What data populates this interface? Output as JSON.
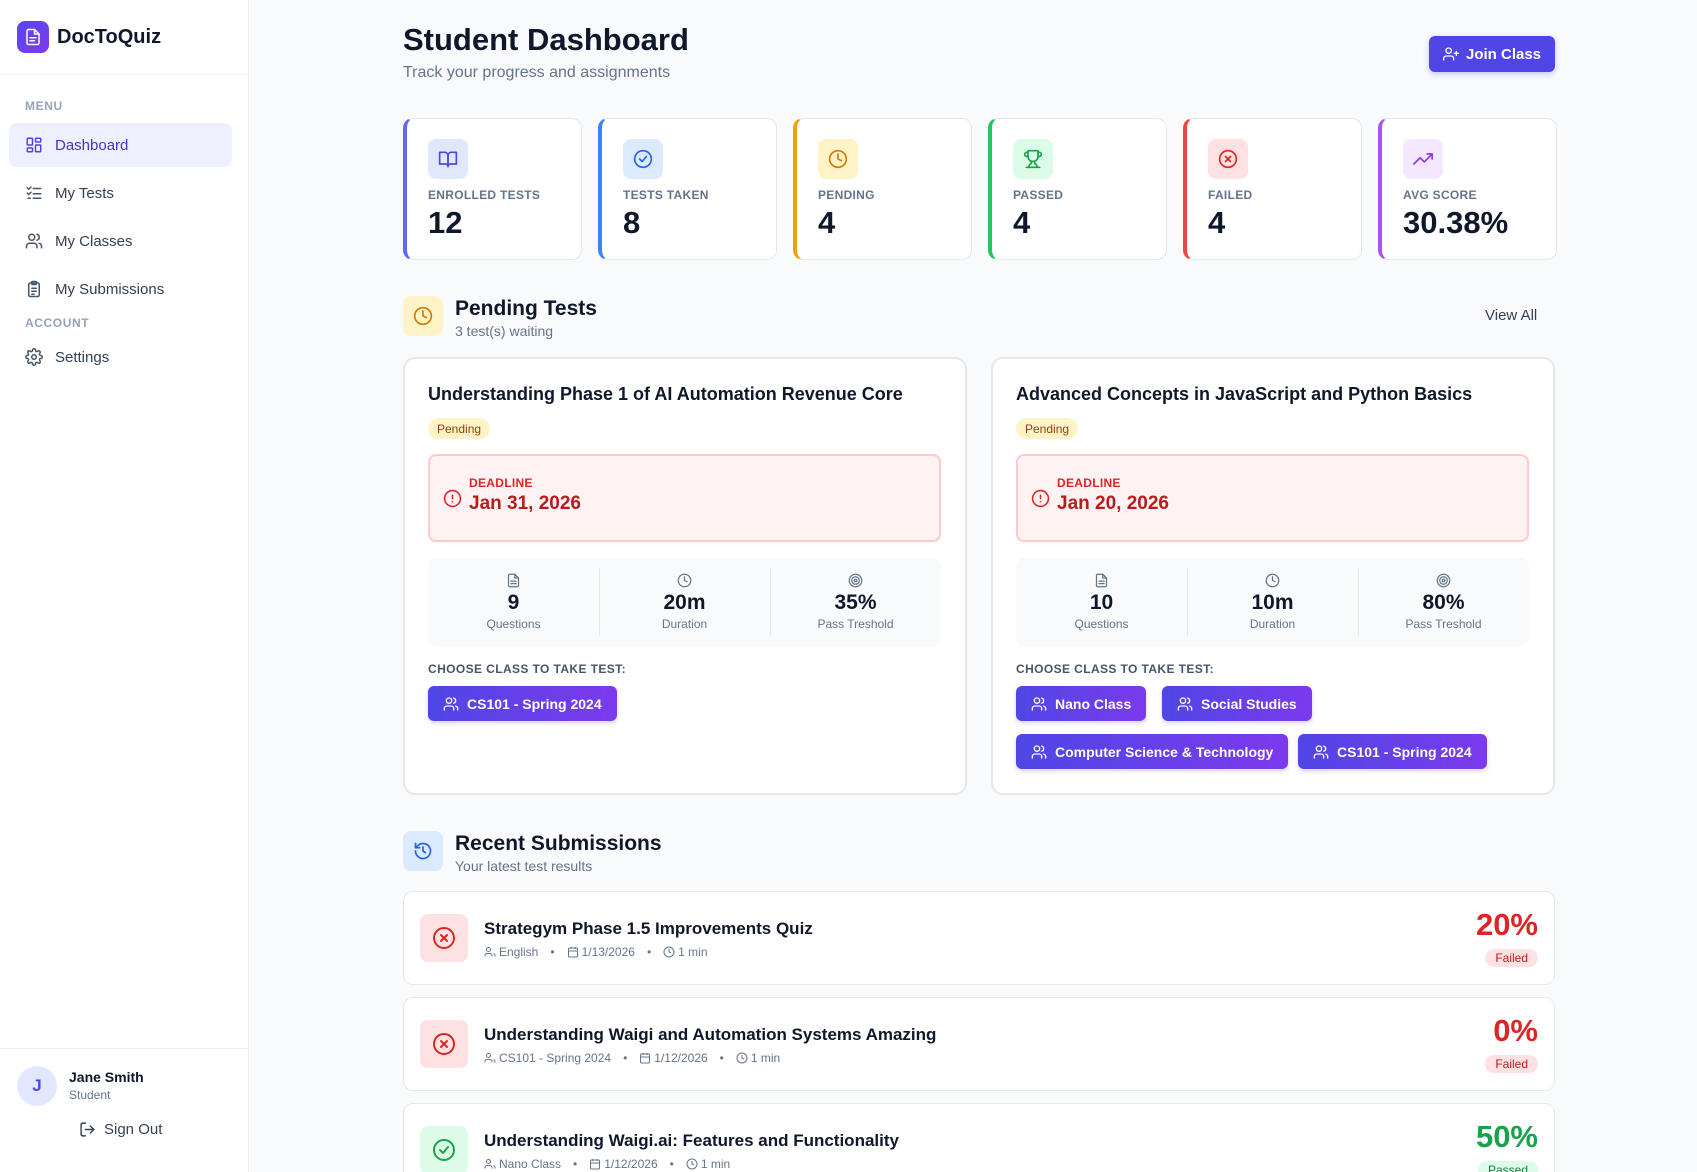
{
  "brand": {
    "name": "DocToQuiz"
  },
  "sidebar": {
    "menu_label": "MENU",
    "account_label": "ACCOUNT",
    "items": [
      {
        "label": "Dashboard",
        "icon": "dashboard-icon"
      },
      {
        "label": "My Tests",
        "icon": "list-check-icon"
      },
      {
        "label": "My Classes",
        "icon": "users-icon"
      },
      {
        "label": "My Submissions",
        "icon": "clipboard-icon"
      },
      {
        "label": "Settings",
        "icon": "gear-icon"
      }
    ],
    "user": {
      "initial": "J",
      "name": "Jane Smith",
      "role": "Student"
    },
    "sign_out": "Sign Out"
  },
  "header": {
    "title": "Student Dashboard",
    "subtitle": "Track your progress and assignments",
    "join_button": "Join Class"
  },
  "stats": [
    {
      "label": "ENROLLED TESTS",
      "value": "12",
      "color": "#6366f1",
      "icon": "book-icon"
    },
    {
      "label": "TESTS TAKEN",
      "value": "8",
      "color": "#3b82f6",
      "icon": "check-circle-icon"
    },
    {
      "label": "PENDING",
      "value": "4",
      "color": "#f59e0b",
      "icon": "clock-icon"
    },
    {
      "label": "PASSED",
      "value": "4",
      "color": "#22c55e",
      "icon": "trophy-icon"
    },
    {
      "label": "FAILED",
      "value": "4",
      "color": "#ef4444",
      "icon": "x-circle-icon"
    },
    {
      "label": "AVG SCORE",
      "value": "30.38%",
      "color": "#a855f7",
      "icon": "trending-up-icon"
    }
  ],
  "pending": {
    "title": "Pending Tests",
    "subtitle": "3 test(s) waiting",
    "view_all": "View All",
    "tests": [
      {
        "title": "Understanding Phase 1 of AI Automation Revenue Core",
        "status": "Pending",
        "deadline_label": "DEADLINE",
        "deadline": "Jan 31, 2026",
        "questions": "9",
        "questions_label": "Questions",
        "duration": "20m",
        "duration_label": "Duration",
        "pass": "35%",
        "pass_label": "Pass Treshold",
        "choose_label": "CHOOSE CLASS TO TAKE TEST:",
        "classes": [
          "CS101 - Spring 2024"
        ]
      },
      {
        "title": "Advanced Concepts in JavaScript and Python Basics",
        "status": "Pending",
        "deadline_label": "DEADLINE",
        "deadline": "Jan 20, 2026",
        "questions": "10",
        "questions_label": "Questions",
        "duration": "10m",
        "duration_label": "Duration",
        "pass": "80%",
        "pass_label": "Pass Treshold",
        "choose_label": "CHOOSE CLASS TO TAKE TEST:",
        "classes": [
          "Nano Class",
          "Social Studies",
          "Computer Science & Technology",
          "CS101 - Spring 2024"
        ]
      }
    ]
  },
  "recent": {
    "title": "Recent Submissions",
    "subtitle": "Your latest test results",
    "items": [
      {
        "title": "Strategym Phase 1.5 Improvements Quiz",
        "class": "English",
        "date": "1/13/2026",
        "time": "1 min",
        "score": "20%",
        "status": "Failed"
      },
      {
        "title": "Understanding Waigi and Automation Systems Amazing",
        "class": "CS101 - Spring 2024",
        "date": "1/12/2026",
        "time": "1 min",
        "score": "0%",
        "status": "Failed"
      },
      {
        "title": "Understanding Waigi.ai: Features and Functionality",
        "class": "Nano Class",
        "date": "1/12/2026",
        "time": "1 min",
        "score": "50%",
        "status": "Passed"
      }
    ]
  }
}
